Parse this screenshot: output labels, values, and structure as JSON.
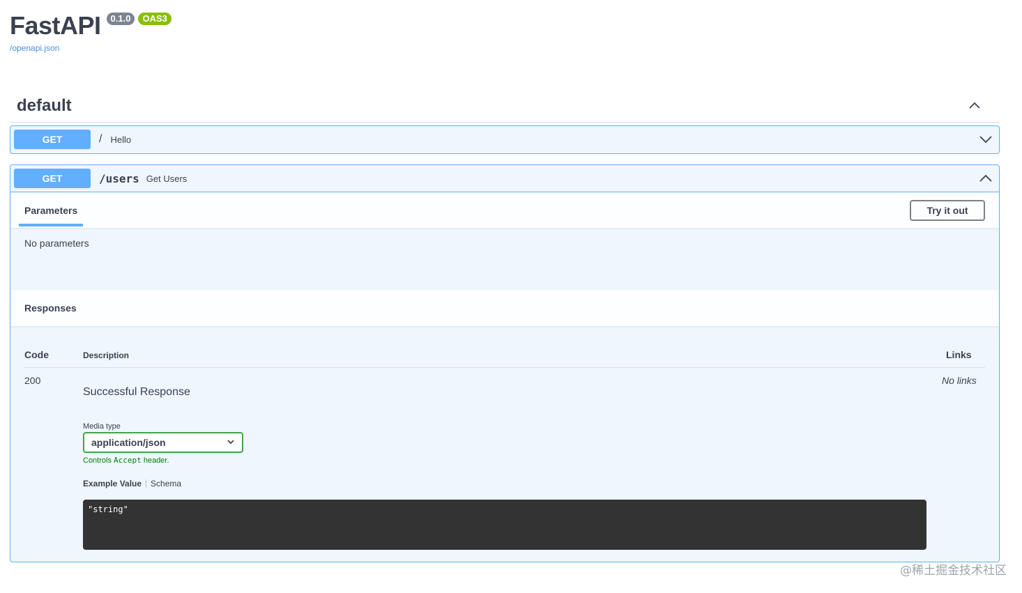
{
  "header": {
    "title": "FastAPI",
    "version_badge": "0.1.0",
    "oas_badge": "OAS3",
    "openapi_link": "/openapi.json"
  },
  "tag": {
    "name": "default"
  },
  "operations": [
    {
      "method": "GET",
      "path": "/",
      "summary": "Hello",
      "expanded": false
    },
    {
      "method": "GET",
      "path": "/users",
      "summary": "Get Users",
      "expanded": true,
      "parameters_tab": "Parameters",
      "try_it_out": "Try it out",
      "no_parameters": "No parameters",
      "responses_title": "Responses",
      "table_headers": {
        "code": "Code",
        "description": "Description",
        "links": "Links"
      },
      "response": {
        "code": "200",
        "description": "Successful Response",
        "media_type_label": "Media type",
        "media_type": "application/json",
        "controls_text_pre": "Controls ",
        "controls_text_code": "Accept",
        "controls_text_post": " header.",
        "example_tab": "Example Value",
        "schema_tab": "Schema",
        "example_code": "\"string\"",
        "links": "No links"
      }
    }
  ],
  "watermark": "@稀土掘金技术社区",
  "colors": {
    "get": "#61affe",
    "get_bg": "#eff6fe",
    "oas_green": "#89bf04",
    "version_gray": "#7d8492",
    "select_green": "#41a446"
  }
}
